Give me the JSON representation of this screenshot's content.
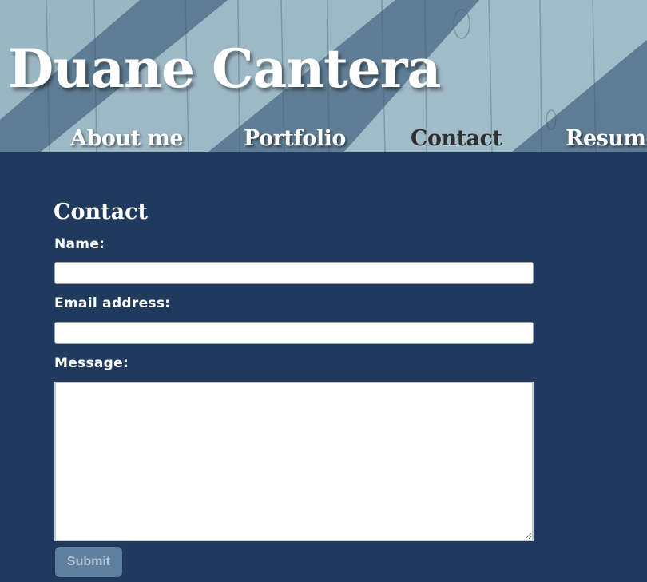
{
  "header": {
    "site_title": "Duane Cantera",
    "nav": [
      {
        "label": "About me",
        "active": false
      },
      {
        "label": "Portfolio",
        "active": false
      },
      {
        "label": "Contact",
        "active": true
      },
      {
        "label": "Resume",
        "active": false
      }
    ]
  },
  "contact": {
    "title": "Contact",
    "name_label": "Name:",
    "name_value": "",
    "email_label": "Email address:",
    "email_value": "",
    "message_label": "Message:",
    "message_value": "",
    "submit_label": "Submit"
  },
  "colors": {
    "page_background": "#203a5e",
    "header_light_wood": "#9bb8c6",
    "header_dark_stripe": "#5f7f96",
    "submit_button": "#5f7f9f",
    "active_nav": "#2f2f2f"
  }
}
